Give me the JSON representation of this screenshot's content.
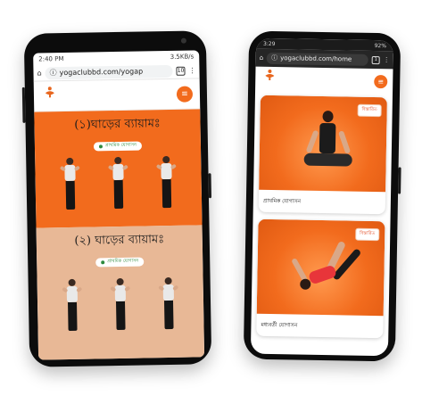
{
  "left_phone": {
    "status": {
      "time": "2:40 PM",
      "network": "3.5KB/s",
      "icons": "Vo WiFi"
    },
    "browser": {
      "url": "yogaclubbd.com/yogap",
      "tab_count": "10"
    },
    "panels": [
      {
        "title": "(১)ঘাড়ের ব্যায়ামঃ",
        "badge": "প্রাথমিক যোগাসন"
      },
      {
        "title": "(২) ঘাড়ের ব্যায়ামঃ",
        "badge": "প্রাথমিক যোগাসন"
      }
    ]
  },
  "right_phone": {
    "status": {
      "time": "3:29",
      "battery": "92%"
    },
    "browser": {
      "url": "yogaclubbd.com/home",
      "tab_count": "1"
    },
    "cards": [
      {
        "badge": "বিস্তারিত",
        "label": "প্রাথমিক যোগাসন"
      },
      {
        "badge": "বিস্তারিত",
        "label": "মধ্যবর্তী যোগাসন"
      }
    ]
  },
  "colors": {
    "brand_orange": "#f26b1d",
    "light_panel": "#e8b896",
    "badge_green": "#2d8a3e",
    "badge_red": "#e2451c"
  },
  "icons": [
    "home-icon",
    "info-icon",
    "tab-count-icon",
    "more-vert-icon",
    "menu-icon",
    "logo-icon"
  ]
}
